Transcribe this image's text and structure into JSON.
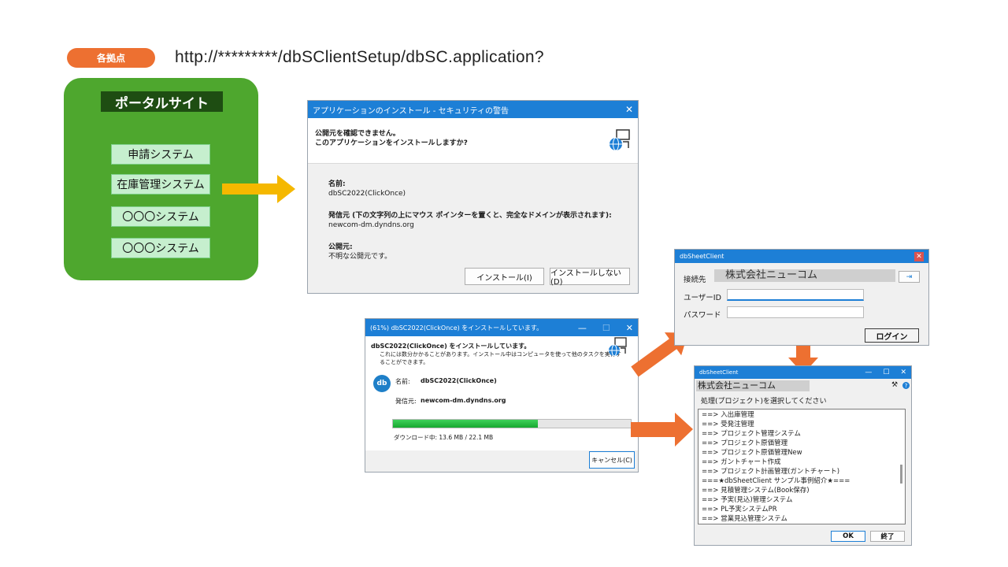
{
  "top": {
    "tag": "各拠点",
    "url": "http://*********/dbSClientSetup/dbSC.application?"
  },
  "portal": {
    "title": "ポータルサイト",
    "items": [
      "申請システム",
      "在庫管理システム",
      "〇〇〇システム",
      "〇〇〇システム"
    ]
  },
  "security_dialog": {
    "title": "アプリケーションのインストール - セキュリティの警告",
    "heading_line1": "公開元を確認できません。",
    "heading_line2": "このアプリケーションをインストールしますか?",
    "name_label": "名前:",
    "name_value": "dbSC2022(ClickOnce)",
    "from_label": "発信元 (下の文字列の上にマウス ポインターを置くと、完全なドメインが表示されます):",
    "from_value": "newcom-dm.dyndns.org",
    "publisher_label": "公開元:",
    "publisher_value": "不明な公開元です。",
    "install_button": "インストール(I)",
    "dont_install_button": "インストールしない(D)"
  },
  "progress_dialog": {
    "title": "(61%) dbSC2022(ClickOnce) をインストールしています。",
    "heading": "dbSC2022(ClickOnce) をインストールしています。",
    "note_line1": "これには数分かかることがあります。インストール中はコンピュータを使って他のタスクを実行す",
    "note_line2": "ることができます。",
    "name_label": "名前:",
    "name_value": "dbSC2022(ClickOnce)",
    "from_label": "発信元:",
    "from_value": "newcom-dm.dyndns.org",
    "progress": 0.61,
    "download_text": "ダウンロード中: 13.6 MB / 22.1 MB",
    "cancel_button": "キャンセル(C)",
    "logo_text": "db"
  },
  "login_dialog": {
    "title": "dbSheetClient",
    "connect_label": "接続先",
    "connect_value": "株式会社ニューコム",
    "user_label": "ユーザーID",
    "password_label": "パスワード",
    "login_button": "ログイン"
  },
  "client_window": {
    "title": "dbSheetClient",
    "company": "株式会社ニューコム",
    "prompt": "処理(プロジェクト)を選択してください",
    "items": [
      "==> 入出庫管理",
      "==> 受発注管理",
      "==> プロジェクト管理システム",
      "==> プロジェクト原価管理",
      "==> プロジェクト原価管理New",
      "==> ガントチャート作成",
      "==> プロジェクト計画管理(ガントチャート)",
      "===★dbSheetClient サンプル事例紹介★===",
      "==> 見積管理システム(Book保存)",
      "==> 予実(見込)管理システム",
      "==> PL予実システムPR",
      "==> 営業見込管理システム"
    ],
    "ok_button": "OK",
    "exit_button": "終了"
  },
  "colors": {
    "portal_green": "#4ea72e",
    "orange": "#ed7031",
    "yellow_arrow": "#f5b800",
    "title_blue": "#1d7fd6",
    "progress_green": "#21b23c"
  }
}
